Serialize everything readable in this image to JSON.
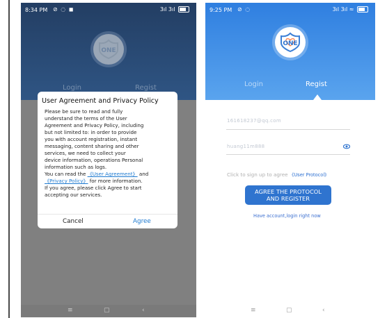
{
  "phone_left": {
    "status": {
      "time": "8:34 PM",
      "icons": [
        "⊘",
        "◌",
        "◼"
      ],
      "right": "3ıl 3ıl"
    },
    "tabs": {
      "login": "Login",
      "regist": "Regist"
    },
    "dialog": {
      "title": "User Agreement and Privacy Policy",
      "body_lines": [
        "Please be sure to read and fully",
        "understand the terms of the User",
        "Agreement and Privacy Policy, including",
        "but not limited to: in order to provide",
        "you with account registration, instant",
        "messaging, content sharing and other",
        "services, we need to collect your",
        "device information, operations Personal",
        "information such as logs."
      ],
      "readmore_prefix": "You can read the ",
      "user_agreement_link": "《User Agreement》",
      "and_text": " and",
      "privacy_policy_link": "《Privacy Policy》",
      "readmore_suffix": " for more information.",
      "agree_line_1": "If you agree, please click Agree to start",
      "agree_line_2": "accepting our services.",
      "cancel": "Cancel",
      "agree": "Agree"
    },
    "nav": {
      "menu": "≡",
      "home": "▢",
      "back": "‹"
    }
  },
  "phone_right": {
    "status": {
      "time": "9:25 PM",
      "icons": [
        "⊘",
        "◌"
      ],
      "right": "3ıl 3ıl ≈"
    },
    "tabs": {
      "login": "Login",
      "regist": "Regist"
    },
    "email_value": "161618237@qq.com",
    "password_value": "huang11m888",
    "signup_text": "Click to sign up to agree ",
    "user_protocol_link": "《User Protocol》",
    "agree_button_line1": "AGREE THE PROTOCOL",
    "agree_button_line2": "AND REGISTER",
    "have_account": "Have account,login right now",
    "nav": {
      "menu": "≡",
      "home": "▢",
      "back": "‹"
    }
  },
  "logo_text": "ONE",
  "colors": {
    "primary_blue": "#2f74cf",
    "link_blue": "#1e7ad0",
    "header_blue": "#3a8ae5"
  }
}
